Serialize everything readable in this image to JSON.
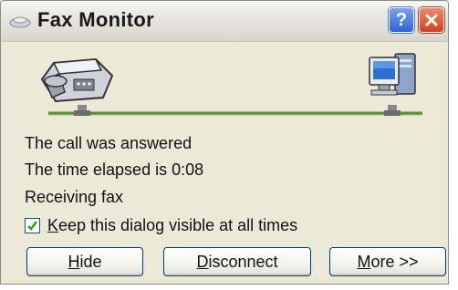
{
  "window": {
    "title": "Fax Monitor",
    "help_symbol": "?",
    "close_symbol": "X"
  },
  "status": {
    "line1": "The call was answered",
    "line2": "The time elapsed is 0:08",
    "line3": "Receiving fax"
  },
  "checkbox": {
    "checked": true,
    "label_mnemonic": "K",
    "label_rest": "eep this dialog visible at all times"
  },
  "buttons": {
    "hide": {
      "mnemonic": "H",
      "rest": "ide"
    },
    "disconnect": {
      "mnemonic": "D",
      "rest": "isconnect"
    },
    "more": {
      "mnemonic": "M",
      "rest": "ore >>"
    }
  },
  "colors": {
    "window_bg": "#ece9d8",
    "line_green": "#5a8f2e",
    "button_border": "#003c74",
    "close_red": "#d3401d",
    "help_blue": "#2e62d6"
  },
  "icons": [
    "fax-machine-icon",
    "computer-icon",
    "connection-line",
    "check-icon",
    "help-icon",
    "close-icon",
    "title-app-icon"
  ]
}
